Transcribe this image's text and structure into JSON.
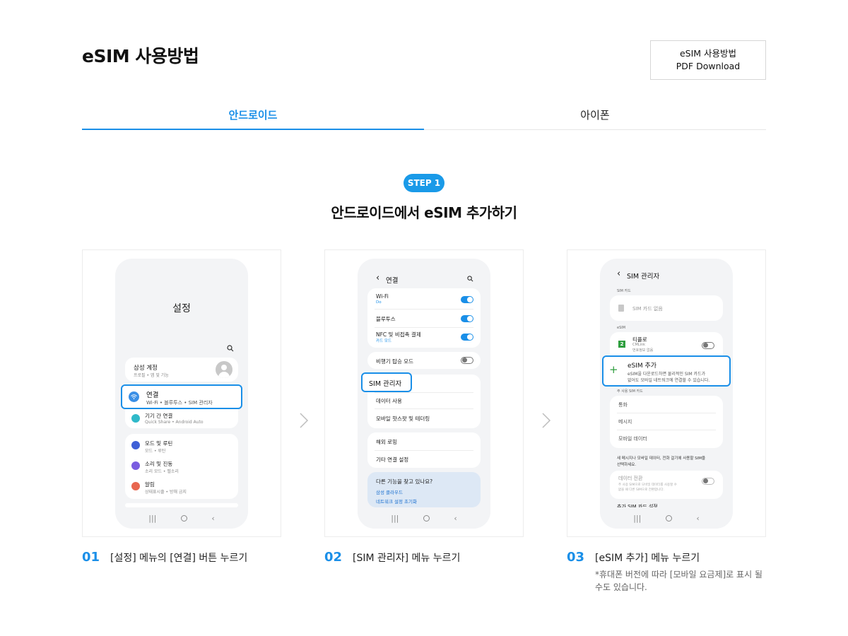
{
  "header": {
    "title": "eSIM 사용방법",
    "pdf_line1": "eSIM 사용방법",
    "pdf_line2": "PDF Download"
  },
  "tabs": [
    {
      "label": "안드로이드",
      "active": true
    },
    {
      "label": "아이폰",
      "active": false
    }
  ],
  "step": {
    "badge": "STEP 1",
    "title": "안드로이드에서 eSIM 추가하기"
  },
  "colors": {
    "accent": "#1a8fe8",
    "badge": "#1a9ae8",
    "esim_green": "#2e9e3e"
  },
  "screen1": {
    "title": "설정",
    "account_title": "삼성 계정",
    "account_sub": "프로필 • 앱 및 기능",
    "conn_title": "연결",
    "conn_sub": "Wi-Fi • 블루투스 • SIM 관리자",
    "device_title": "기기 간 연결",
    "device_sub": "Quick Share • Android Auto",
    "mode_title": "모드 및 루틴",
    "mode_sub": "모드 • 루틴",
    "sound_title": "소리 및 진동",
    "sound_sub": "소리 모드 • 벨소리",
    "noti_title": "알림",
    "noti_sub": "상태표시줄 • 방해 금지"
  },
  "screen2": {
    "header": "연결",
    "wifi_title": "Wi-Fi",
    "wifi_sub": "Do",
    "bt_title": "블루투스",
    "nfc_title": "NFC 및 비접촉 결제",
    "nfc_sub": "카드 모드",
    "airplane_title": "비행기 탑승 모드",
    "sim_title": "SIM 관리자",
    "data_title": "데이터 사용",
    "hotspot_title": "모바일 핫스팟 및 테더링",
    "roaming_title": "해외 로밍",
    "other_title": "기타 연결 설정",
    "tip_title": "다른 기능을 찾고 있나요?",
    "tip_link1": "삼성 클라우드",
    "tip_link2": "네트워크 설정 초기화"
  },
  "screen3": {
    "header": "SIM 관리자",
    "simcard_section": "SIM 카드",
    "no_sim": "SIM 카드 없음",
    "esim_section": "eSIM",
    "esim_entry_title": "티플로",
    "esim_entry_sub1": "CMLink",
    "esim_entry_sub2": "번호정보 없음",
    "esim_entry_num": "2",
    "add_title": "eSIM 추가",
    "add_sub1": "eSIM을 다운로드하면 물리적인 SIM 카드가",
    "add_sub2": "없어도 모바일 네트워크에 연결할 수 있습니다.",
    "preferred_section": "주 사용 SIM 카드",
    "call": "통화",
    "message": "메시지",
    "mobile_data": "모바일 데이터",
    "choose_text1": "새 메시지나 모바일 데이터, 전화 걸기에 사용할 SIM을",
    "choose_text2": "선택하세요.",
    "data_switch_title": "데이터 전환",
    "data_switch_sub1": "주 사용 SIM으로 모바일 데이터를 사용할 수",
    "data_switch_sub2": "없을 때 다른 SIM으로 전환합니다.",
    "more_settings": "추가 SIM 카드 설정"
  },
  "captions": [
    {
      "num": "01",
      "text": "[설정] 메뉴의 [연결] 버튼 누르기"
    },
    {
      "num": "02",
      "text": "[SIM 관리자] 메뉴 누르기"
    },
    {
      "num": "03",
      "text": "[eSIM 추가] 메뉴 누르기",
      "note": "*휴대폰 버전에 따라 [모바일 요금제]로 표시 될 수도 있습니다."
    }
  ]
}
